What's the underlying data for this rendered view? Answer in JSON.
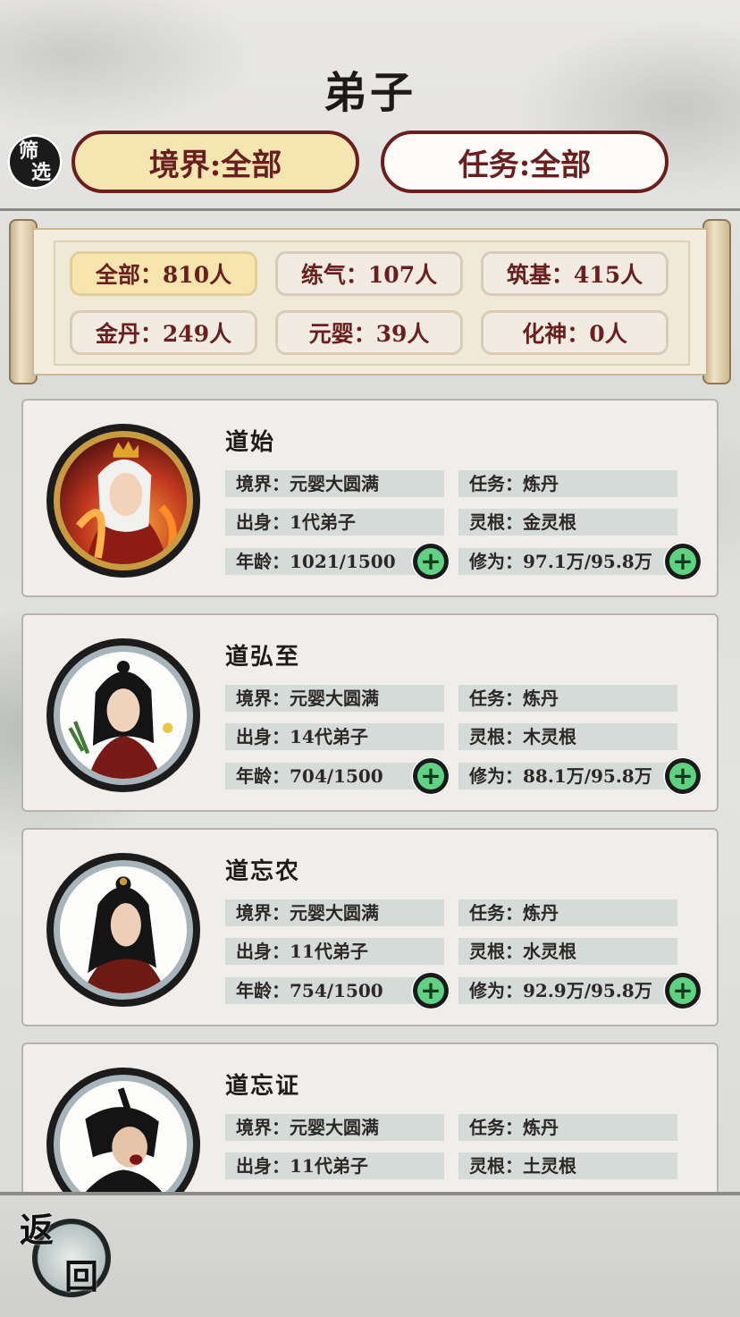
{
  "page": {
    "title": "弟子"
  },
  "filter": {
    "icon_top": "筛",
    "icon_bottom": "选",
    "realm_label": "境界:全部",
    "task_label": "任务:全部"
  },
  "stats": [
    {
      "label": "全部：810人",
      "active": true
    },
    {
      "label": "练气：107人",
      "active": false
    },
    {
      "label": "筑基：415人",
      "active": false
    },
    {
      "label": "金丹：249人",
      "active": false
    },
    {
      "label": "元婴：39人",
      "active": false
    },
    {
      "label": "化神：0人",
      "active": false
    }
  ],
  "disciples": [
    {
      "name": "道始",
      "realm": "境界：元婴大圆满",
      "task": "任务：炼丹",
      "origin": "出身：1代弟子",
      "root": "灵根：金灵根",
      "age": "年龄：1021/1500",
      "cultivation": "修为：97.1万/95.8万",
      "frame": "gold"
    },
    {
      "name": "道弘至",
      "realm": "境界：元婴大圆满",
      "task": "任务：炼丹",
      "origin": "出身：14代弟子",
      "root": "灵根：木灵根",
      "age": "年龄：704/1500",
      "cultivation": "修为：88.1万/95.8万",
      "frame": "silver"
    },
    {
      "name": "道忘农",
      "realm": "境界：元婴大圆满",
      "task": "任务：炼丹",
      "origin": "出身：11代弟子",
      "root": "灵根：水灵根",
      "age": "年龄：754/1500",
      "cultivation": "修为：92.9万/95.8万",
      "frame": "silver"
    },
    {
      "name": "道忘证",
      "realm": "境界：元婴大圆满",
      "task": "任务：炼丹",
      "origin": "出身：11代弟子",
      "root": "灵根：土灵根",
      "age": "",
      "cultivation": "",
      "frame": "silver"
    }
  ],
  "footer": {
    "back_top": "返",
    "back_bottom": "回"
  },
  "colors": {
    "accent": "#6a1f1f",
    "active_tab": "#f5e6b1",
    "plus_green": "#5fd383"
  },
  "icons": {
    "filter": "filter-seal-icon",
    "plus": "plus-icon",
    "back": "back-seal-icon"
  }
}
